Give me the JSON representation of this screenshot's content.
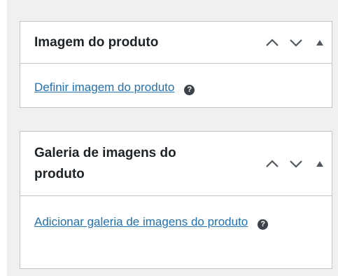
{
  "panels": [
    {
      "title": "Imagem do produto",
      "link": "Definir imagem do produto",
      "help": "?"
    },
    {
      "title": "Galeria de imagens do produto",
      "link": "Adicionar galeria de imagens do produto",
      "help": "?"
    }
  ],
  "icons": {
    "up": "chevron-up-icon",
    "down": "chevron-down-icon",
    "toggle": "triangle-up-icon"
  },
  "colors": {
    "link": "#2271b1",
    "text": "#1d2327",
    "border": "#c3c4c7",
    "background": "#f0f0f1"
  }
}
